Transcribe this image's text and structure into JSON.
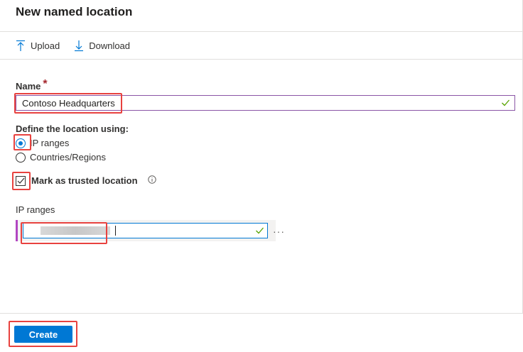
{
  "title": "New named location",
  "toolbar": {
    "upload_label": "Upload",
    "download_label": "Download"
  },
  "form": {
    "name_label": "Name",
    "required_marker": "*",
    "name_value": "Contoso Headquarters",
    "define_label": "Define the location using:",
    "options": [
      {
        "label": "IP ranges",
        "selected": true
      },
      {
        "label": "Countries/Regions",
        "selected": false
      }
    ],
    "trusted_label": "Mark as trusted location",
    "trusted_checked": true,
    "ip_ranges_label": "IP ranges",
    "ip_ranges_menu": "···"
  },
  "footer": {
    "create_label": "Create"
  },
  "colors": {
    "accent": "#0078d4",
    "highlight": "#e8423f",
    "valid": "#57a300",
    "required": "#a4262c"
  }
}
